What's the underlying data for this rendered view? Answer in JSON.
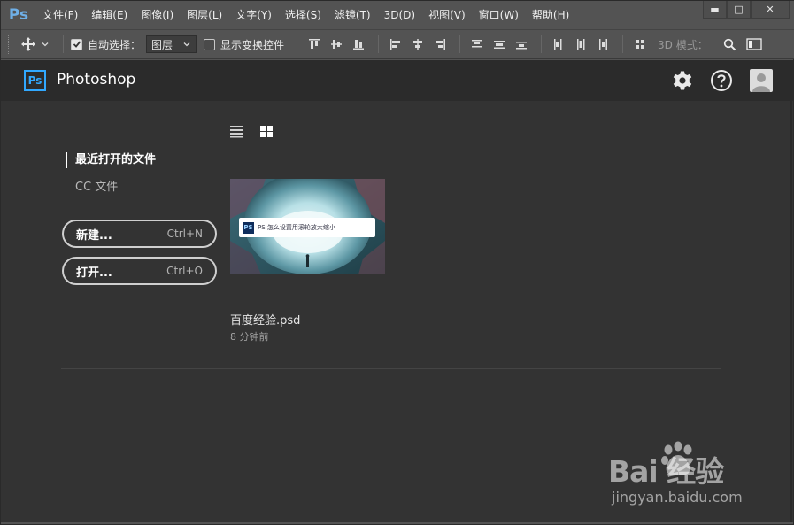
{
  "app": {
    "logo": "Ps"
  },
  "menu": [
    "文件(F)",
    "编辑(E)",
    "图像(I)",
    "图层(L)",
    "文字(Y)",
    "选择(S)",
    "滤镜(T)",
    "3D(D)",
    "视图(V)",
    "窗口(W)",
    "帮助(H)"
  ],
  "window_controls": {
    "minimize": "▬",
    "maximize": "□",
    "close": "✕"
  },
  "toolbar": {
    "auto_select_label": "自动选择：",
    "auto_select_checked": true,
    "auto_select_target": "图层",
    "show_transform_label": "显示变换控件",
    "show_transform_checked": false,
    "mode_3d_label": "3D 模式："
  },
  "start": {
    "logo": "Ps",
    "title": "Photoshop",
    "nav": {
      "recent": "最近打开的文件",
      "cc_files": "CC 文件"
    },
    "buttons": {
      "new_label": "新建...",
      "new_shortcut": "Ctrl+N",
      "open_label": "打开...",
      "open_shortcut": "Ctrl+O"
    },
    "recent_files": [
      {
        "name": "百度经验.psd",
        "time": "8 分钟前",
        "thumb_logo": "PS",
        "thumb_text": "PS 怎么设置用滚轮放大缩小"
      }
    ]
  },
  "watermark": {
    "brand": "Bai  经验",
    "url": "jingyan.baidu.com"
  }
}
